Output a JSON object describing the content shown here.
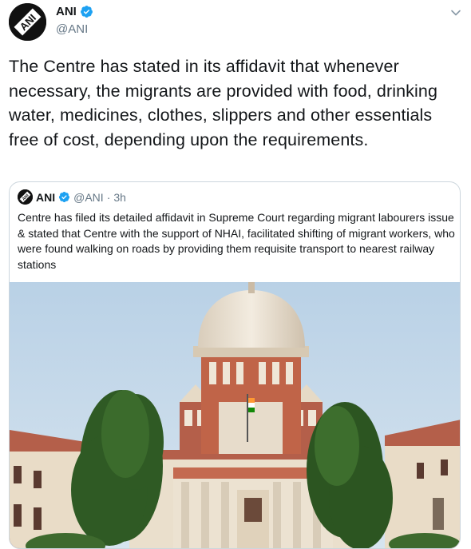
{
  "tweet": {
    "display_name": "ANI",
    "handle": "@ANI",
    "text": "The Centre has stated in its affidavit that whenever necessary, the migrants are provided with food, drinking water, medicines, clothes, slippers and other essentials free of cost, depending upon the requirements.",
    "avatar_text": "ANI",
    "verified_icon": "verified-badge-icon",
    "menu_icon": "chevron-down-icon"
  },
  "quote": {
    "display_name": "ANI",
    "handle": "@ANI",
    "separator": "·",
    "time": "3h",
    "text": "Centre has filed its detailed affidavit in Supreme Court regarding migrant labourers issue & stated that Centre with the support of NHAI, facilitated shifting of migrant workers, who were found walking on roads by providing them requisite transport to nearest railway stations",
    "image": "supreme-court-building-photo"
  },
  "colors": {
    "text": "#14171a",
    "secondary": "#657786",
    "verified": "#1da1f2",
    "border": "#ccd6dd"
  }
}
